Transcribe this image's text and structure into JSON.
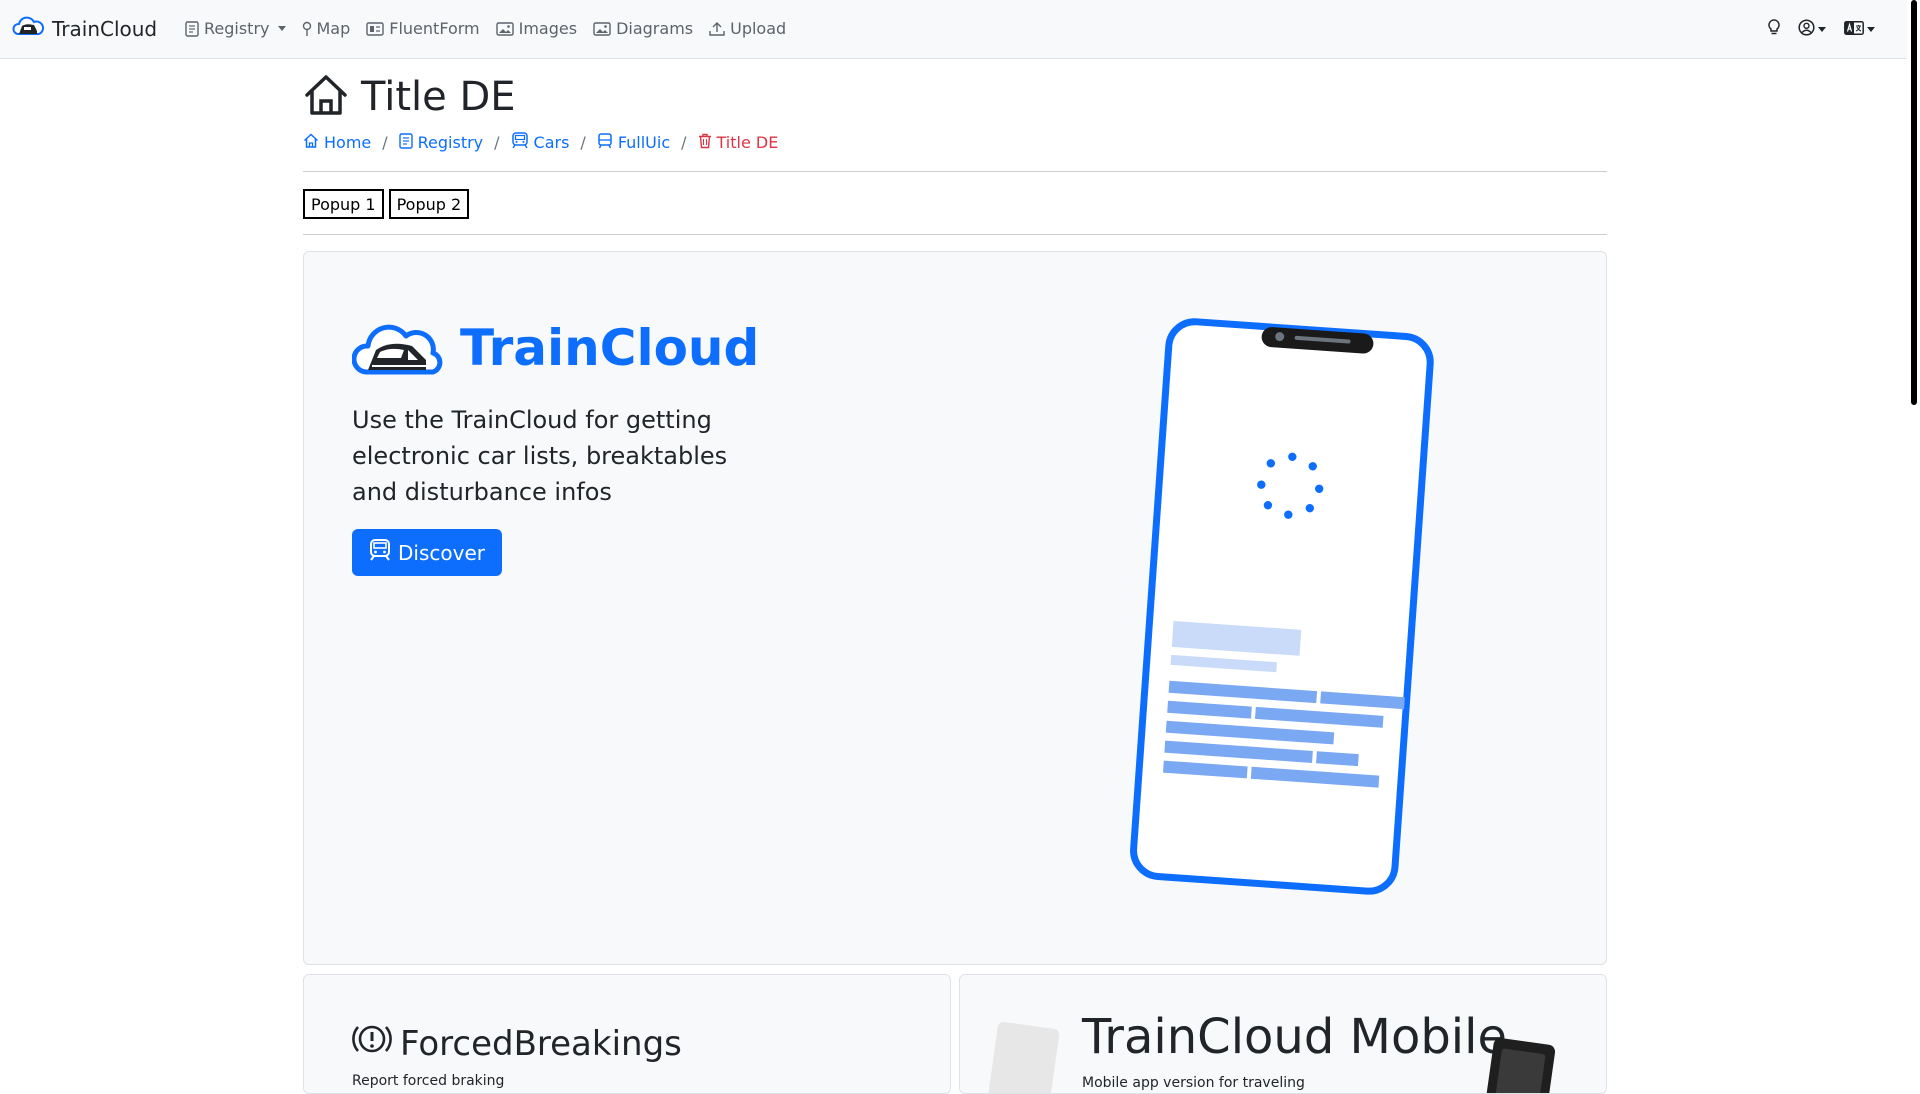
{
  "navbar": {
    "brand": "TrainCloud",
    "items": [
      {
        "label": "Registry",
        "icon": "registry-icon",
        "dropdown": true
      },
      {
        "label": "Map",
        "icon": "map-pin-icon"
      },
      {
        "label": "FluentForm",
        "icon": "form-icon"
      },
      {
        "label": "Images",
        "icon": "image-icon"
      },
      {
        "label": "Diagrams",
        "icon": "diagram-icon"
      },
      {
        "label": "Upload",
        "icon": "upload-icon"
      }
    ],
    "right_icons": [
      "lightbulb-icon",
      "user-circle-icon",
      "language-icon"
    ]
  },
  "page": {
    "title": "Title DE",
    "title_icon": "home-icon"
  },
  "breadcrumb": [
    {
      "label": "Home",
      "icon": "home-icon"
    },
    {
      "label": "Registry",
      "icon": "registry-icon"
    },
    {
      "label": "Cars",
      "icon": "train-icon"
    },
    {
      "label": "FullUic",
      "icon": "train-front-icon"
    },
    {
      "label": "Title DE",
      "icon": "trash-icon",
      "active": true
    }
  ],
  "popups": [
    "Popup 1",
    "Popup 2"
  ],
  "hero": {
    "brand": "TrainCloud",
    "description": "Use the TrainCloud for getting electronic car lists, breaktables and disturbance infos",
    "button_label": "Discover"
  },
  "cards": {
    "forced": {
      "title": "ForcedBreakings",
      "subtitle": "Report forced braking"
    },
    "mobile": {
      "title": "TrainCloud Mobile",
      "subtitle": "Mobile app version for traveling"
    }
  },
  "colors": {
    "primary": "#0d6efd",
    "danger": "#dc3545",
    "navbar_bg": "#f8f9fa",
    "text": "#212529"
  }
}
